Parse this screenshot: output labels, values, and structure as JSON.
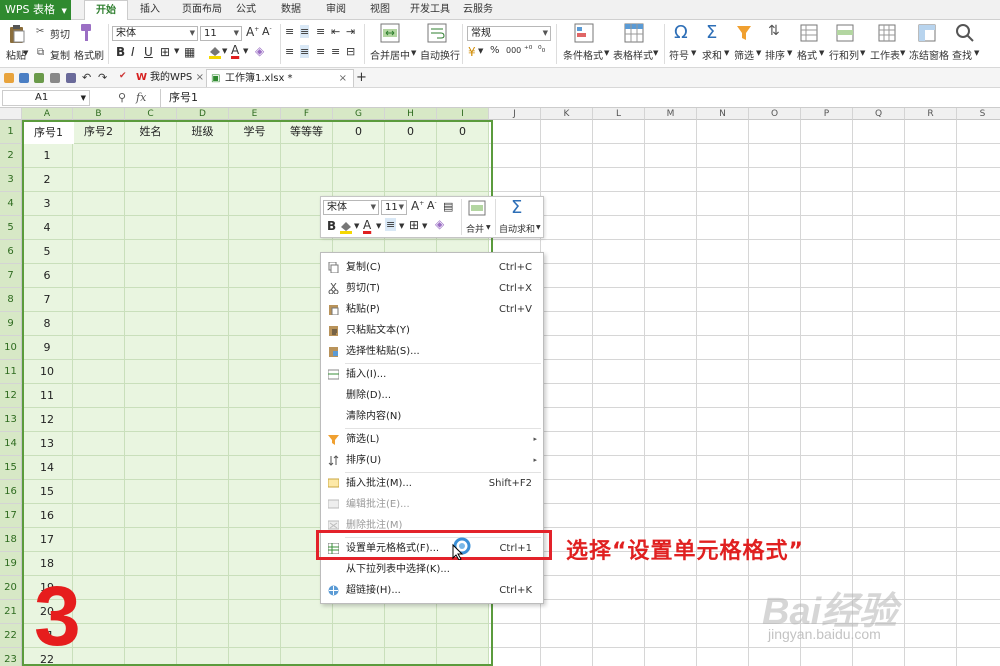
{
  "app_button": "WPS 表格",
  "menu_tabs": [
    "开始",
    "插入",
    "页面布局",
    "公式",
    "数据",
    "审阅",
    "视图",
    "开发工具",
    "云服务"
  ],
  "ribbon": {
    "paste": "粘贴",
    "cut": "剪切",
    "copy": "复制",
    "format_painter": "格式刷",
    "font_name": "宋体",
    "font_size": "11",
    "number_format": "常规",
    "merge_center": "合并居中",
    "wrap_text": "自动换行",
    "cond_format": "条件格式",
    "table_style": "表格样式",
    "symbol": "符号",
    "sum": "求和",
    "filter": "筛选",
    "sort": "排序",
    "format": "格式",
    "row_col": "行和列",
    "worksheet": "工作表",
    "freeze": "冻结窗格",
    "find": "查找",
    "percent": "%",
    "thousands": "000"
  },
  "tabs": {
    "tab1": "我的WPS",
    "tab2": "工作簿1.xlsx *",
    "add": "+"
  },
  "formula_bar": {
    "name_box": "A1",
    "fx": "fx",
    "content": "序号1"
  },
  "columns": [
    "A",
    "B",
    "C",
    "D",
    "E",
    "F",
    "G",
    "H",
    "I",
    "J",
    "K",
    "L",
    "M",
    "N",
    "O",
    "P",
    "Q",
    "R",
    "S"
  ],
  "rows": [
    "1",
    "2",
    "3",
    "4",
    "5",
    "6",
    "7",
    "8",
    "9",
    "10",
    "11",
    "12",
    "13",
    "14",
    "15",
    "16",
    "17",
    "18",
    "19",
    "20",
    "21",
    "22",
    "23"
  ],
  "header_row": [
    "序号1",
    "序号2",
    "姓名",
    "班级",
    "学号",
    "等等等",
    "0",
    "0",
    "0"
  ],
  "col_a_values": [
    "1",
    "2",
    "3",
    "4",
    "5",
    "6",
    "7",
    "8",
    "9",
    "10",
    "11",
    "12",
    "13",
    "14",
    "15",
    "16",
    "17",
    "18",
    "19",
    "20",
    "21",
    "22"
  ],
  "mini_toolbar": {
    "font": "宋体",
    "size": "11",
    "merge": "合并",
    "autosum": "自动求和"
  },
  "context_menu": [
    {
      "label": "复制(C)",
      "shortcut": "Ctrl+C",
      "icon": "copy-icon",
      "enabled": true
    },
    {
      "label": "剪切(T)",
      "shortcut": "Ctrl+X",
      "icon": "scissors-icon",
      "enabled": true
    },
    {
      "label": "粘贴(P)",
      "shortcut": "Ctrl+V",
      "icon": "paste-icon",
      "enabled": true
    },
    {
      "label": "只粘贴文本(Y)",
      "shortcut": "",
      "icon": "paste-text-icon",
      "enabled": true
    },
    {
      "label": "选择性粘贴(S)...",
      "shortcut": "",
      "icon": "paste-special-icon",
      "enabled": true
    },
    {
      "label": "插入(I)...",
      "shortcut": "",
      "icon": "insert-icon",
      "enabled": true
    },
    {
      "label": "删除(D)...",
      "shortcut": "",
      "icon": "",
      "enabled": true
    },
    {
      "label": "清除内容(N)",
      "shortcut": "",
      "icon": "",
      "enabled": true
    },
    {
      "label": "筛选(L)",
      "shortcut": "",
      "icon": "filter-icon",
      "enabled": true,
      "submenu": true
    },
    {
      "label": "排序(U)",
      "shortcut": "",
      "icon": "sort-icon",
      "enabled": true,
      "submenu": true
    },
    {
      "label": "插入批注(M)...",
      "shortcut": "Shift+F2",
      "icon": "comment-icon",
      "enabled": true
    },
    {
      "label": "编辑批注(E)...",
      "shortcut": "",
      "icon": "edit-comment-icon",
      "enabled": false
    },
    {
      "label": "删除批注(M)",
      "shortcut": "",
      "icon": "delete-comment-icon",
      "enabled": false
    },
    {
      "label": "设置单元格格式(F)...",
      "shortcut": "Ctrl+1",
      "icon": "format-cells-icon",
      "enabled": true
    },
    {
      "label": "从下拉列表中选择(K)...",
      "shortcut": "",
      "icon": "",
      "enabled": true
    },
    {
      "label": "超链接(H)...",
      "shortcut": "Ctrl+K",
      "icon": "hyperlink-icon",
      "enabled": true
    }
  ],
  "annotation": "选择“设置单元格格式”",
  "step_number": "3",
  "watermark": "Bai经验",
  "watermark_url": "jingyan.baidu.com",
  "colors": {
    "accent_green": "#2f8a2f",
    "selection_fill": "#e9f5e0",
    "highlight_red": "#e3222a"
  }
}
